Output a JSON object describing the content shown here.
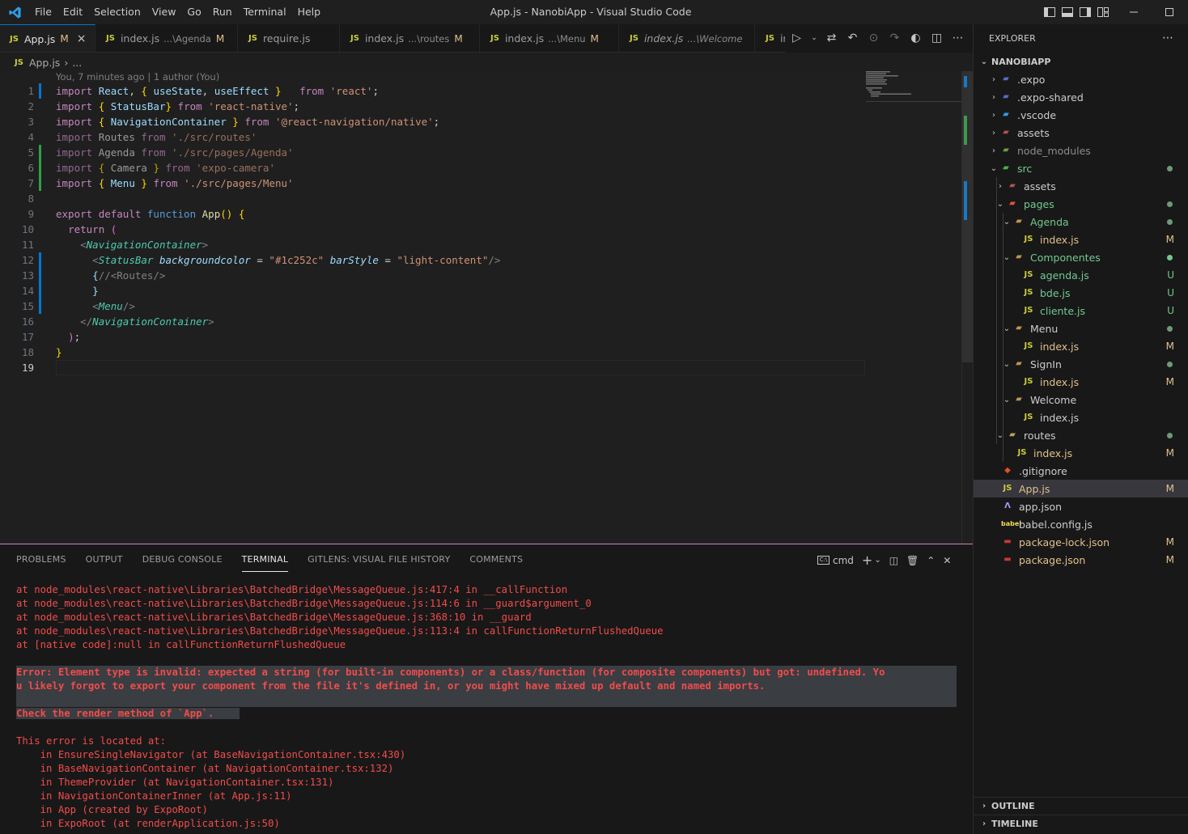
{
  "window": {
    "title": "App.js - NanobiApp - Visual Studio Code"
  },
  "menu": [
    "File",
    "Edit",
    "Selection",
    "View",
    "Go",
    "Run",
    "Terminal",
    "Help"
  ],
  "tabs": [
    {
      "name": "App.js",
      "desc": "",
      "status": "M"
    },
    {
      "name": "index.js",
      "desc": "...\\Agenda",
      "status": "M"
    },
    {
      "name": "require.js",
      "desc": "",
      "status": ""
    },
    {
      "name": "index.js",
      "desc": "...\\routes",
      "status": "M"
    },
    {
      "name": "index.js",
      "desc": "...\\Menu",
      "status": "M"
    },
    {
      "name": "index.js",
      "desc": "...\\Welcome",
      "status": ""
    },
    {
      "name": "in",
      "desc": "",
      "status": ""
    }
  ],
  "breadcrumb": {
    "file": "App.js",
    "sep": "›",
    "rest": "..."
  },
  "editor": {
    "blame": "You, 7 minutes ago | 1 author (You)",
    "line_numbers": [
      "1",
      "2",
      "3",
      "4",
      "5",
      "6",
      "7",
      "8",
      "9",
      "10",
      "11",
      "12",
      "13",
      "14",
      "15",
      "16",
      "17",
      "18",
      "19"
    ],
    "lines": [
      "import React, { useState, useEffect }   from 'react';",
      "import { StatusBar} from 'react-native';",
      "import { NavigationContainer } from '@react-navigation/native';",
      "import Routes from './src/routes'",
      "import Agenda from './src/pages/Agenda'",
      "import { Camera } from 'expo-camera'",
      "import { Menu } from './src/pages/Menu'",
      "",
      "export default function App() {",
      "  return (",
      "    <NavigationContainer>",
      "      <StatusBar backgroundcolor = \"#1c252c\" barStyle = \"light-content\"/>",
      "      {//<Routes/>",
      "      }",
      "      <Menu/>",
      "    </NavigationContainer>",
      "  );",
      "}",
      ""
    ]
  },
  "panel": {
    "tabs": [
      "PROBLEMS",
      "OUTPUT",
      "DEBUG CONSOLE",
      "TERMINAL",
      "GITLENS: VISUAL FILE HISTORY",
      "COMMENTS"
    ],
    "active_tab": "TERMINAL",
    "shell": "cmd",
    "terminal_lines": [
      "at node_modules\\react-native\\Libraries\\BatchedBridge\\MessageQueue.js:417:4 in __callFunction",
      "at node_modules\\react-native\\Libraries\\BatchedBridge\\MessageQueue.js:114:6 in __guard$argument_0",
      "at node_modules\\react-native\\Libraries\\BatchedBridge\\MessageQueue.js:368:10 in __guard",
      "at node_modules\\react-native\\Libraries\\BatchedBridge\\MessageQueue.js:113:4 in callFunctionReturnFlushedQueue",
      "at [native code]:null in callFunctionReturnFlushedQueue",
      "",
      "Error: Element type is invalid: expected a string (for built-in components) or a class/function (for composite components) but got: undefined. Yo",
      "u likely forgot to export your component from the file it's defined in, or you might have mixed up default and named imports.",
      "",
      "Check the render method of `App`.",
      "",
      "This error is located at:",
      "    in EnsureSingleNavigator (at BaseNavigationContainer.tsx:430)",
      "    in BaseNavigationContainer (at NavigationContainer.tsx:132)",
      "    in ThemeProvider (at NavigationContainer.tsx:131)",
      "    in NavigationContainerInner (at App.js:11)",
      "    in App (created by ExpoRoot)",
      "    in ExpoRoot (at renderApplication.js:50)"
    ]
  },
  "explorer": {
    "header": "EXPLORER",
    "project": "NANOBIAPP",
    "tree": [
      {
        "label": ".expo",
        "status": ""
      },
      {
        "label": ".expo-shared",
        "status": ""
      },
      {
        "label": ".vscode",
        "status": ""
      },
      {
        "label": "assets",
        "status": ""
      },
      {
        "label": "node_modules",
        "status": ""
      },
      {
        "label": "src",
        "status": ""
      },
      {
        "label": "assets",
        "status": ""
      },
      {
        "label": "pages",
        "status": ""
      },
      {
        "label": "Agenda",
        "status": ""
      },
      {
        "label": "index.js",
        "status": "M"
      },
      {
        "label": "Componentes",
        "status": ""
      },
      {
        "label": "agenda.js",
        "status": "U"
      },
      {
        "label": "bde.js",
        "status": "U"
      },
      {
        "label": "cliente.js",
        "status": "U"
      },
      {
        "label": "Menu",
        "status": ""
      },
      {
        "label": "index.js",
        "status": "M"
      },
      {
        "label": "SignIn",
        "status": ""
      },
      {
        "label": "index.js",
        "status": "M"
      },
      {
        "label": "Welcome",
        "status": ""
      },
      {
        "label": "index.js",
        "status": ""
      },
      {
        "label": "routes",
        "status": ""
      },
      {
        "label": "index.js",
        "status": "M"
      },
      {
        "label": ".gitignore",
        "status": ""
      },
      {
        "label": "App.js",
        "status": "M"
      },
      {
        "label": "app.json",
        "status": ""
      },
      {
        "label": "babel.config.js",
        "status": ""
      },
      {
        "label": "package-lock.json",
        "status": "M"
      },
      {
        "label": "package.json",
        "status": "M"
      }
    ],
    "outline": "OUTLINE",
    "timeline": "TIMELINE"
  }
}
